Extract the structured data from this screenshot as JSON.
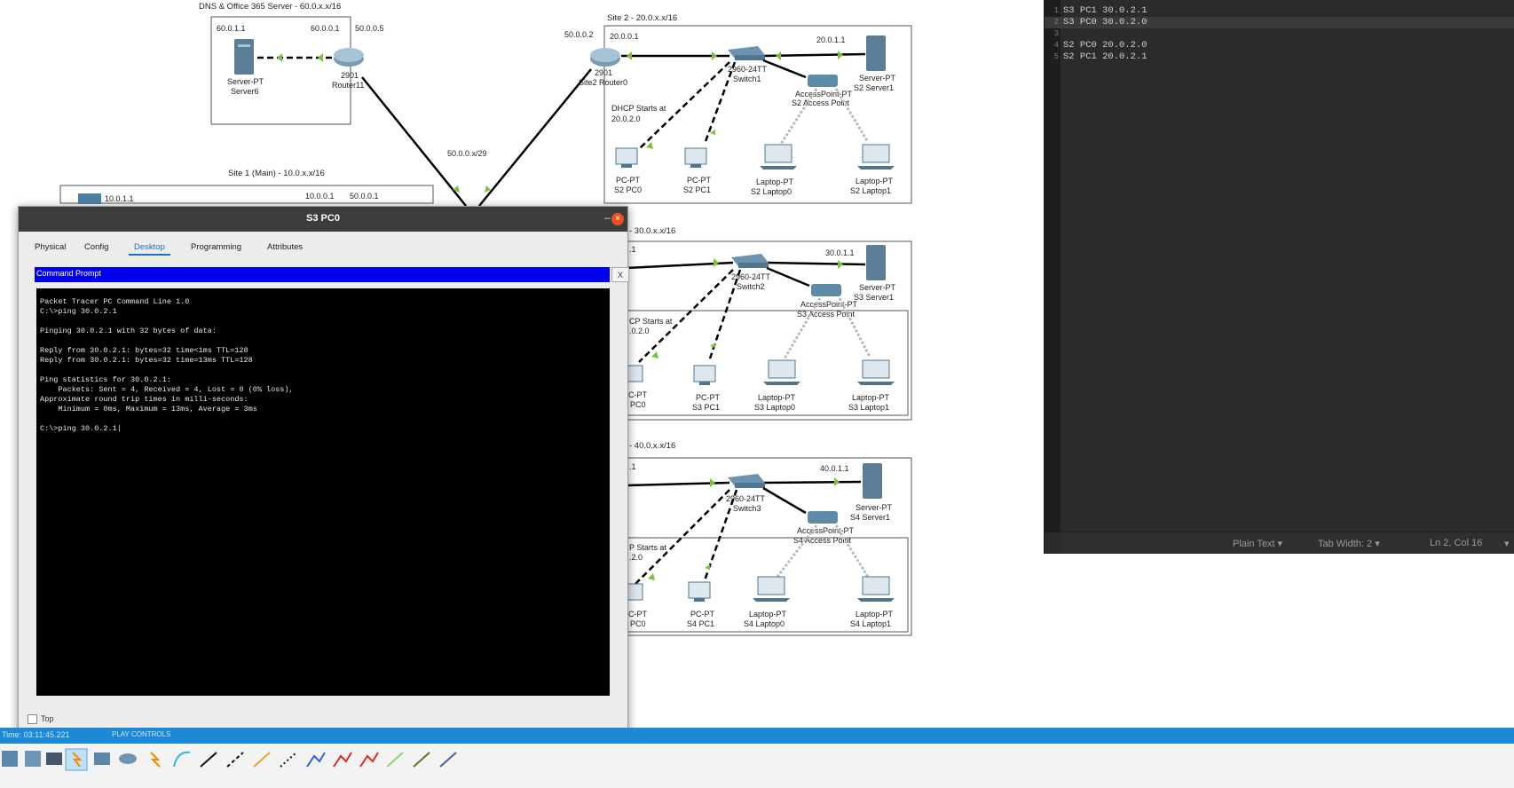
{
  "topology": {
    "dns_site": {
      "title": "DNS & Office 365 Server - 60.0.x.x/16",
      "server_ip": "60.0.1.1",
      "router_ip": "60.0.0.1",
      "wan_ip": "50.0.0.5",
      "server_label1": "Server-PT",
      "server_label2": "Server6",
      "router_label1": "2901",
      "router_label2": "Router11"
    },
    "site1": {
      "title": "Site 1 (Main) - 10.0.x.x/16",
      "ip_left": "10.0.1.1",
      "ip_right": "10.0.0.1",
      "wan_ip": "50.0.0.1"
    },
    "wan_label": "50.0.0.x/29",
    "site2": {
      "title": "Site 2 - 20.0.x.x/16",
      "wan_ip": "50.0.0.2",
      "router_ip": "20.0.0.1",
      "server_ip": "20.0.1.1",
      "router_label1": "2901",
      "router_label2": "Site2 Router0",
      "switch_label1": "2960-24TT",
      "switch_label2": "Switch1",
      "ap_label1": "AccessPoint-PT",
      "ap_label2": "S2 Access Point",
      "server_label1": "Server-PT",
      "server_label2": "S2 Server1",
      "dhcp1": "DHCP Starts at",
      "dhcp2": "20.0.2.0",
      "pc0_1": "PC-PT",
      "pc0_2": "S2 PC0",
      "pc1_1": "PC-PT",
      "pc1_2": "S2 PC1",
      "lap0_1": "Laptop-PT",
      "lap0_2": "S2 Laptop0",
      "lap1_1": "Laptop-PT",
      "lap1_2": "S2 Laptop1"
    },
    "site3": {
      "title": "- 30.0.x.x/16",
      "router_ip_partial": ".1",
      "server_ip": "30.0.1.1",
      "switch_label1": "2960-24TT",
      "switch_label2": "Switch2",
      "ap_label1": "AccessPoint-PT",
      "ap_label2": "S3 Access Point",
      "server_label1": "Server-PT",
      "server_label2": "S3 Server1",
      "dhcp1": "CP Starts at",
      "dhcp2": ".0.2.0",
      "pc0_1": "C-PT",
      "pc0_2": "PC0",
      "pc1_1": "PC-PT",
      "pc1_2": "S3 PC1",
      "lap0_1": "Laptop-PT",
      "lap0_2": "S3 Laptop0",
      "lap1_1": "Laptop-PT",
      "lap1_2": "S3 Laptop1"
    },
    "site4": {
      "title": "- 40.0.x.x/16",
      "router_ip_partial": ".1",
      "server_ip": "40.0.1.1",
      "switch_label1": "2960-24TT",
      "switch_label2": "Switch3",
      "ap_label1": "AccessPoint-PT",
      "ap_label2": "S4 Access Point",
      "server_label1": "Server-PT",
      "server_label2": "S4 Server1",
      "dhcp1": "P Starts at",
      "dhcp2": ".2.0",
      "pc0_1": "C-PT",
      "pc0_2": "PC0",
      "pc1_1": "PC-PT",
      "pc1_2": "S4 PC1",
      "lap0_1": "Laptop-PT",
      "lap0_2": "S4 Laptop0",
      "lap1_1": "Laptop-PT",
      "lap1_2": "S4 Laptop1"
    }
  },
  "editor": {
    "lines": [
      {
        "num": "1",
        "text": "S3 PC1 30.0.2.1"
      },
      {
        "num": "2",
        "text": "S3 PC0 30.0.2.0"
      },
      {
        "num": "3",
        "text": ""
      },
      {
        "num": "4",
        "text": "S2 PC0 20.0.2.0"
      },
      {
        "num": "5",
        "text": "S2 PC1 20.0.2.1"
      }
    ],
    "status": {
      "mode": "Plain Text ▾",
      "tab": "Tab Width: 2 ▾",
      "pos": "Ln 2, Col 16",
      "arrow": "▾"
    }
  },
  "pc_window": {
    "title": "S3 PC0",
    "min": "–",
    "close": "×",
    "tabs": [
      "Physical",
      "Config",
      "Desktop",
      "Programming",
      "Attributes"
    ],
    "active_tab": "Desktop",
    "cmd_title": "Command Prompt",
    "cmd_close": "X",
    "terminal": [
      "Packet Tracer PC Command Line 1.0",
      "C:\\>ping 30.0.2.1",
      "",
      "Pinging 30.0.2.1 with 32 bytes of data:",
      "",
      "Reply from 30.0.2.1: bytes=32 time<1ms TTL=128",
      "Reply from 30.0.2.1: bytes=32 time=13ms TTL=128",
      "",
      "Ping statistics for 30.0.2.1:",
      "    Packets: Sent = 4, Received = 4, Lost = 0 (0% loss),",
      "Approximate round trip times in milli-seconds:",
      "    Minimum = 0ms, Maximum = 13ms, Average = 3ms",
      "",
      "C:\\>ping 30.0.2.1|"
    ],
    "top_label": "Top"
  },
  "status_bar": {
    "time": "Time: 03:11:45.221",
    "realtime": "PLAY CONTROLS"
  }
}
